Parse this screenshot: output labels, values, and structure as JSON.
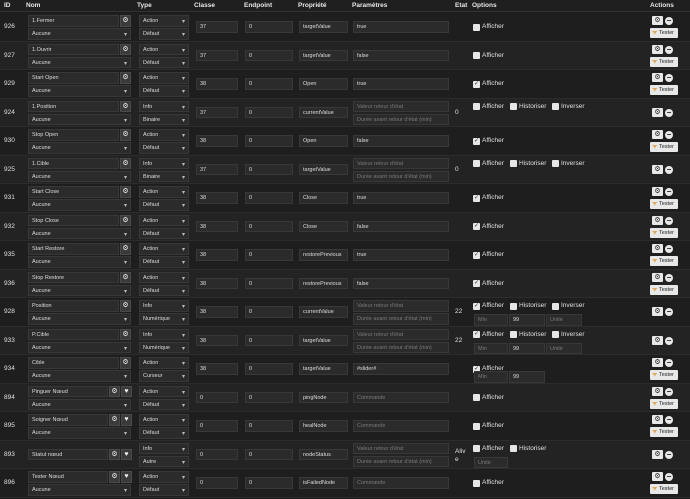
{
  "header": {
    "id": "ID",
    "nom": "Nom",
    "type": "Type",
    "classe": "Classe",
    "endpoint": "Endpoint",
    "propriete": "Propriété",
    "parametres": "Paramètres",
    "etat": "Etat",
    "options": "Options",
    "actions": "Actions"
  },
  "labels": {
    "afficher": "Afficher",
    "historiser": "Historiser",
    "inverser": "Inverser",
    "tester": "Tester",
    "min": "Min",
    "max_val": "99",
    "unite": "Unité",
    "valeur_retour": "Valeur retour d'état",
    "duree_retour": "Durée avant retour d'état (min)",
    "commande": "Commande"
  },
  "rows": [
    {
      "id": "926",
      "nom": "1.Fermer",
      "parent": "Aucune",
      "type": "Action",
      "subtype": "Défaut",
      "classe": "37",
      "endpoint": "0",
      "prop": "targetValue",
      "param": "true",
      "etat": "",
      "afficher": false
    },
    {
      "id": "927",
      "nom": "1.Ouvrir",
      "parent": "Aucune",
      "type": "Action",
      "subtype": "Défaut",
      "classe": "37",
      "endpoint": "0",
      "prop": "targetValue",
      "param": "false",
      "etat": "",
      "afficher": false
    },
    {
      "id": "929",
      "nom": "Start Open",
      "parent": "Aucune",
      "type": "Action",
      "subtype": "Défaut",
      "classe": "38",
      "endpoint": "0",
      "prop": "Open",
      "param": "true",
      "etat": "",
      "afficher": true
    },
    {
      "id": "924",
      "nom": "1.Position",
      "parent": "Aucune",
      "type": "Info",
      "subtype": "Binaire",
      "classe": "37",
      "endpoint": "0",
      "prop": "currentValue",
      "param": "",
      "etat": "0",
      "afficher": false
    },
    {
      "id": "930",
      "nom": "Stop Open",
      "parent": "Aucune",
      "type": "Action",
      "subtype": "Défaut",
      "classe": "38",
      "endpoint": "0",
      "prop": "Open",
      "param": "false",
      "etat": "",
      "afficher": true
    },
    {
      "id": "925",
      "nom": "1.Cible",
      "parent": "Aucune",
      "type": "Info",
      "subtype": "Binaire",
      "classe": "37",
      "endpoint": "0",
      "prop": "targetValue",
      "param": "",
      "etat": "0",
      "afficher": false
    },
    {
      "id": "931",
      "nom": "Start Close",
      "parent": "Aucune",
      "type": "Action",
      "subtype": "Défaut",
      "classe": "38",
      "endpoint": "0",
      "prop": "Close",
      "param": "true",
      "etat": "",
      "afficher": true
    },
    {
      "id": "932",
      "nom": "Stop Close",
      "parent": "Aucune",
      "type": "Action",
      "subtype": "Défaut",
      "classe": "38",
      "endpoint": "0",
      "prop": "Close",
      "param": "false",
      "etat": "",
      "afficher": true
    },
    {
      "id": "935",
      "nom": "Start Restore",
      "parent": "Aucune",
      "type": "Action",
      "subtype": "Défaut",
      "classe": "38",
      "endpoint": "0",
      "prop": "restorePrevious",
      "param": "true",
      "etat": "",
      "afficher": true
    },
    {
      "id": "936",
      "nom": "Stop Restore",
      "parent": "Aucune",
      "type": "Action",
      "subtype": "Défaut",
      "classe": "38",
      "endpoint": "0",
      "prop": "restorePrevious",
      "param": "false",
      "etat": "",
      "afficher": true
    },
    {
      "id": "928",
      "nom": "Position",
      "parent": "Aucune",
      "type": "Info",
      "subtype": "Numérique",
      "classe": "38",
      "endpoint": "0",
      "prop": "currentValue",
      "param": "",
      "etat": "22",
      "afficher": true
    },
    {
      "id": "933",
      "nom": "P.Cible",
      "parent": "Aucune",
      "type": "Info",
      "subtype": "Numérique",
      "classe": "38",
      "endpoint": "0",
      "prop": "targetValue",
      "param": "",
      "etat": "22",
      "afficher": true
    },
    {
      "id": "934",
      "nom": "Cible",
      "parent": "Aucune",
      "type": "Action",
      "subtype": "Curseur",
      "classe": "38",
      "endpoint": "0",
      "prop": "targetValue",
      "param": "#slider#",
      "etat": "",
      "afficher": true
    },
    {
      "id": "894",
      "nom": "Pinguer Nœud",
      "parent": "Aucune",
      "type": "Action",
      "subtype": "Défaut",
      "classe": "0",
      "endpoint": "0",
      "prop": "pingNode",
      "param": "",
      "etat": "",
      "afficher": false
    },
    {
      "id": "895",
      "nom": "Soigner Nœud",
      "parent": "Aucune",
      "type": "Action",
      "subtype": "Défaut",
      "classe": "0",
      "endpoint": "0",
      "prop": "healNode",
      "param": "",
      "etat": "",
      "afficher": false
    },
    {
      "id": "893",
      "nom": "Statut nœud",
      "parent": "",
      "type": "Info",
      "subtype": "Autre",
      "classe": "0",
      "endpoint": "0",
      "prop": "nodeStatus",
      "param": "",
      "etat": "Aliv e",
      "afficher": false
    },
    {
      "id": "896",
      "nom": "Tester Nœud",
      "parent": "Aucune",
      "type": "Action",
      "subtype": "Défaut",
      "classe": "0",
      "endpoint": "0",
      "prop": "isFailedNode",
      "param": "",
      "etat": "",
      "afficher": false
    }
  ],
  "colors": {
    "background": "#1b1b1b",
    "row_alt": "#232323",
    "input": "#2b2b2b",
    "accent_rss": "#d97c00"
  }
}
